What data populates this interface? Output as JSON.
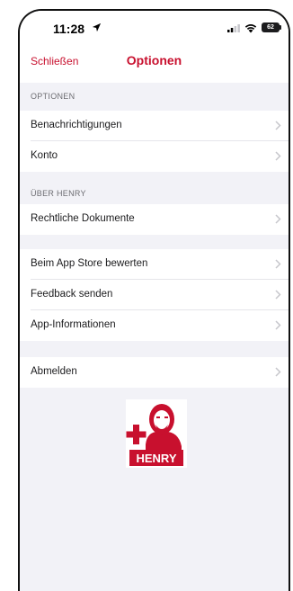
{
  "status_bar": {
    "time": "11:28",
    "battery": "62",
    "icons": [
      "location-arrow-icon",
      "signal-icon",
      "wifi-icon",
      "battery-icon"
    ]
  },
  "nav": {
    "close_label": "Schließen",
    "title": "Optionen"
  },
  "sections": {
    "optionen_header": "OPTIONEN",
    "ueber_header": "ÜBER HENRY"
  },
  "rows": {
    "benachrichtigungen": "Benachrichtigungen",
    "konto": "Konto",
    "rechtliche_dokumente": "Rechtliche Dokumente",
    "app_store": "Beim App Store bewerten",
    "feedback": "Feedback senden",
    "app_info": "App-Informationen",
    "abmelden": "Abmelden"
  },
  "logo": {
    "text": "HENRY"
  },
  "colors": {
    "accent": "#c8102e",
    "background": "#f2f2f7",
    "cell": "#ffffff",
    "secondary_text": "#6d6d72"
  }
}
